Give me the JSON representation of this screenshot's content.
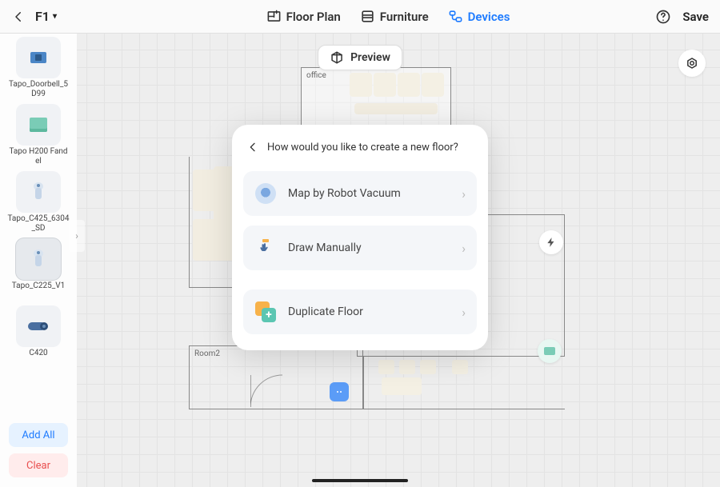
{
  "header": {
    "floor_label": "F1",
    "tabs": {
      "floor_plan": "Floor Plan",
      "furniture": "Furniture",
      "devices": "Devices"
    },
    "active_tab": "devices",
    "save_label": "Save"
  },
  "canvas": {
    "preview_label": "Preview",
    "rooms": {
      "office": "office",
      "room2": "Room2"
    }
  },
  "sidebar": {
    "devices": [
      {
        "label": "Tapo_Doorbell_5D99",
        "icon": "doorbell"
      },
      {
        "label": "Tapo H200 Fandel",
        "icon": "hub"
      },
      {
        "label": "Tapo_C425_6304_SD",
        "icon": "cam-bottle"
      },
      {
        "label": "Tapo_C225_V1",
        "icon": "cam-bottle",
        "selected": true
      },
      {
        "label": "C420",
        "icon": "cam-cyl"
      }
    ],
    "add_all_label": "Add All",
    "clear_label": "Clear"
  },
  "modal": {
    "title": "How would you like to create a new floor?",
    "options": [
      {
        "label": "Map by Robot Vacuum",
        "icon": "robot"
      },
      {
        "label": "Draw Manually",
        "icon": "hand"
      },
      {
        "label": "Duplicate Floor",
        "icon": "duplicate"
      }
    ]
  }
}
